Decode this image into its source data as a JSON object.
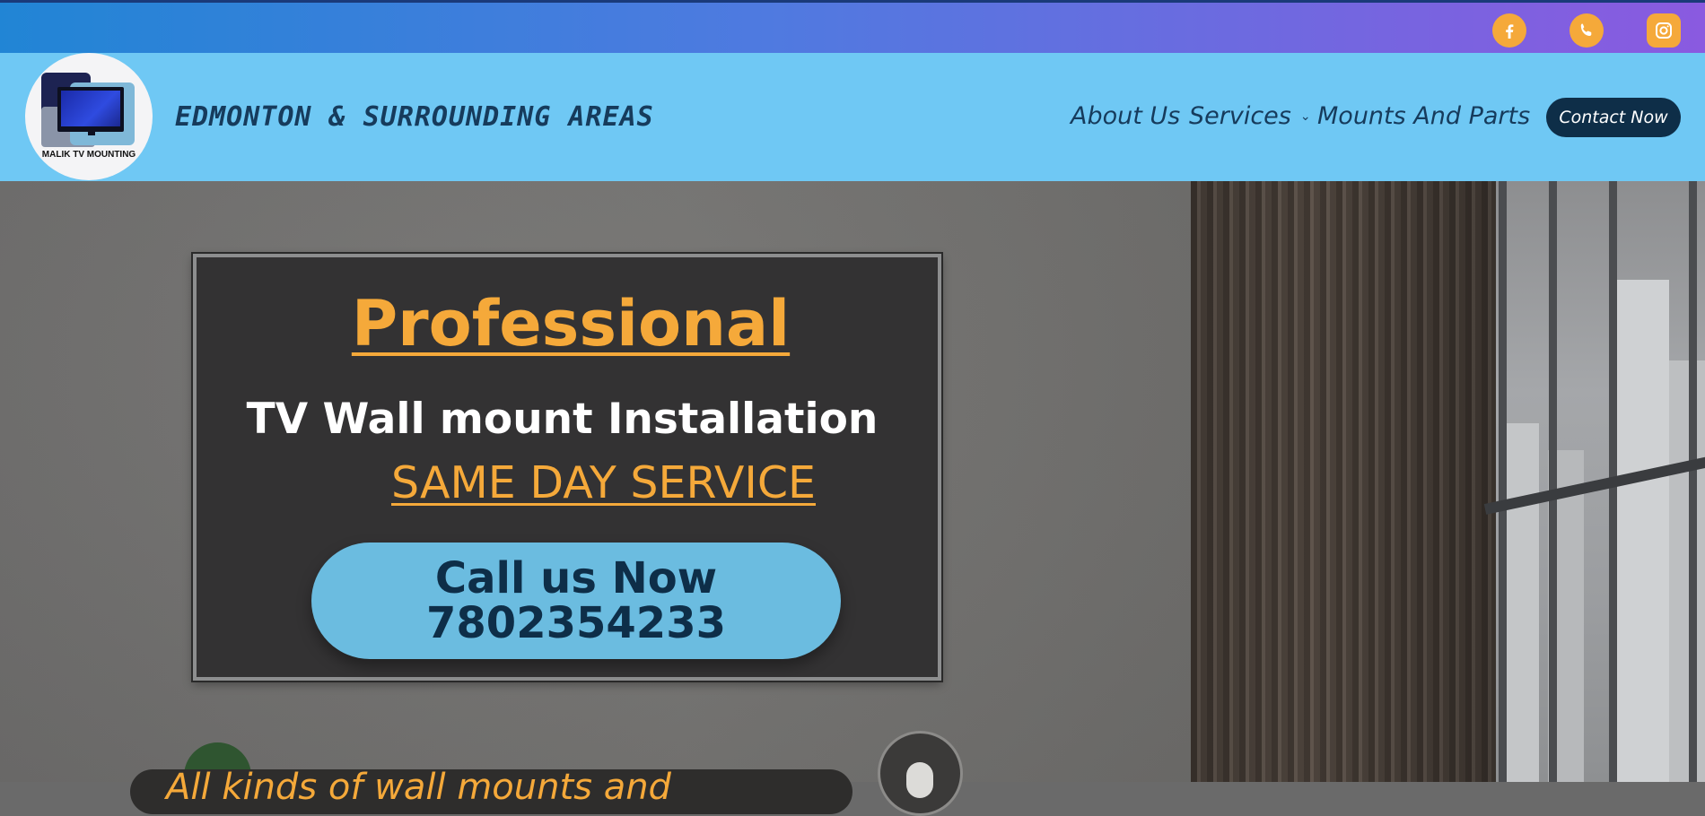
{
  "social": {
    "facebook_icon": "facebook-icon",
    "phone_icon": "whatsapp-phone-icon",
    "instagram_icon": "instagram-icon",
    "accent_color": "#f5a93a"
  },
  "header": {
    "logo_text": "MALIK TV MOUNTING",
    "region": "EDMONTON & SURROUNDING AREAS",
    "nav": {
      "about": "About Us",
      "services": "Services",
      "mounts": "Mounts And Parts"
    },
    "contact_button": "Contact Now"
  },
  "hero": {
    "headline": "Professional",
    "subhead": "TV Wall mount Installation",
    "same_day": "SAME DAY SERVICE",
    "call_line1": "Call us Now",
    "call_line2": "7802354233",
    "bottom_text": "All kinds of wall mounts and"
  },
  "colors": {
    "header_bg": "#6fc8f4",
    "dark_navy": "#0e2e48",
    "orange": "#f5a93a",
    "call_button_bg": "#6bbce0"
  }
}
